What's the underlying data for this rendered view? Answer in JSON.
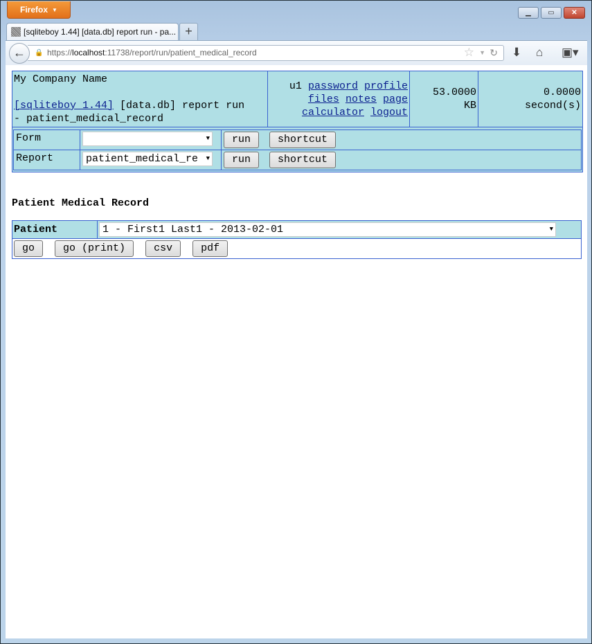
{
  "browser": {
    "menu_button": "Firefox",
    "tab_title": "[sqliteboy 1.44] [data.db] report run - pa...",
    "new_tab": "+",
    "url_prefix": "https://",
    "url_host": "localhost",
    "url_rest": ":11738/report/run/patient_medical_record",
    "icons": [
      "back-arrow-icon",
      "lock-icon",
      "bookmark-star-icon",
      "dropdown-icon",
      "reload-icon",
      "download-icon",
      "home-icon",
      "bookmarks-menu-icon"
    ]
  },
  "header": {
    "company": "My Company Name",
    "app_link": "[sqliteboy 1.44]",
    "context": "[data.db] report run",
    "context2": "- patient_medical_record",
    "user": "u1",
    "links": [
      "password",
      "profile",
      "files",
      "notes",
      "page",
      "calculator",
      "logout"
    ],
    "size_value": "53.0000",
    "size_unit": "KB",
    "time_value": "0.0000",
    "time_unit": "second(s)"
  },
  "forms": {
    "rows": [
      {
        "label": "Form",
        "selected": "",
        "run": "run",
        "shortcut": "shortcut"
      },
      {
        "label": "Report",
        "selected": "patient_medical_re",
        "run": "run",
        "shortcut": "shortcut"
      }
    ]
  },
  "report": {
    "title": "Patient Medical Record",
    "param_label": "Patient",
    "param_value": "1 - First1 Last1 - 2013-02-01",
    "buttons": [
      "go",
      "go (print)",
      "csv",
      "pdf"
    ]
  }
}
